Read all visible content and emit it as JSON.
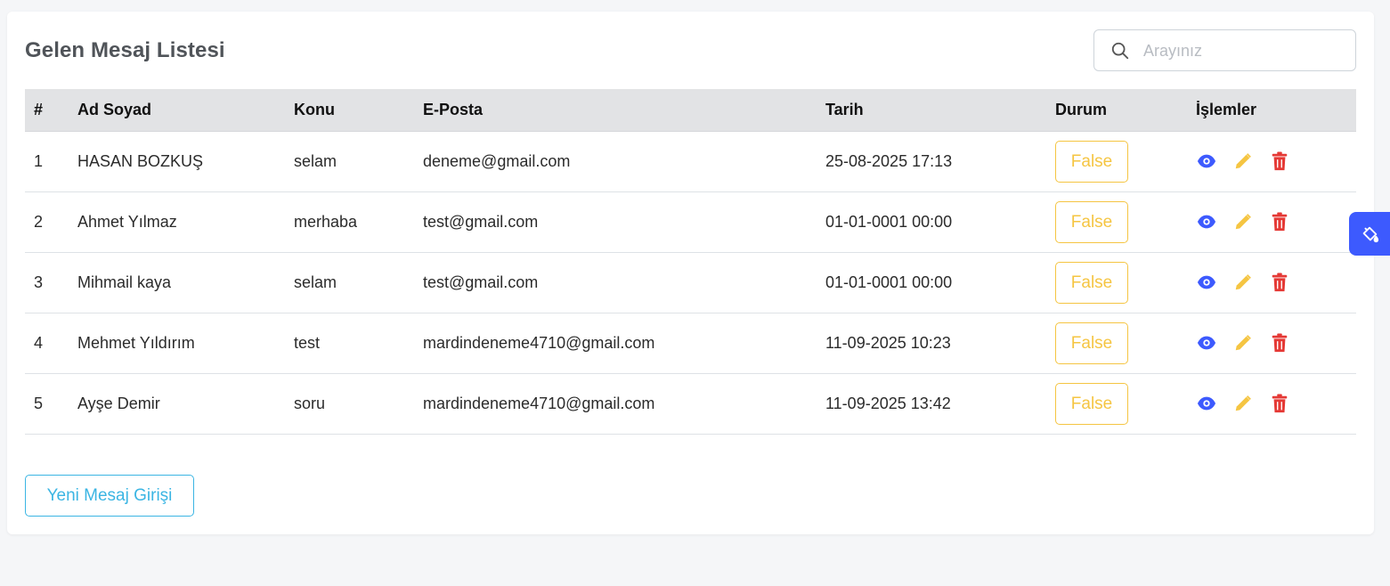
{
  "page": {
    "title": "Gelen Mesaj Listesi"
  },
  "search": {
    "placeholder": "Arayınız",
    "icon": "search-icon"
  },
  "table": {
    "headers": {
      "num": "#",
      "name": "Ad Soyad",
      "topic": "Konu",
      "email": "E-Posta",
      "date": "Tarih",
      "status": "Durum",
      "actions": "İşlemler"
    },
    "rows": [
      {
        "num": "1",
        "name": "HASAN BOZKUŞ",
        "topic": "selam",
        "email": "deneme@gmail.com",
        "date": "25-08-2025 17:13",
        "status": "False"
      },
      {
        "num": "2",
        "name": "Ahmet Yılmaz",
        "topic": "merhaba",
        "email": "test@gmail.com",
        "date": "01-01-0001 00:00",
        "status": "False"
      },
      {
        "num": "3",
        "name": "Mihmail kaya",
        "topic": "selam",
        "email": "test@gmail.com",
        "date": "01-01-0001 00:00",
        "status": "False"
      },
      {
        "num": "4",
        "name": "Mehmet Yıldırım",
        "topic": "test",
        "email": "mardindeneme4710@gmail.com",
        "date": "11-09-2025 10:23",
        "status": "False"
      },
      {
        "num": "5",
        "name": "Ayşe Demir",
        "topic": "soru",
        "email": "mardindeneme4710@gmail.com",
        "date": "11-09-2025 13:42",
        "status": "False"
      }
    ],
    "row_actions": [
      "eye-icon",
      "pencil-icon",
      "trash-icon"
    ]
  },
  "footer": {
    "new_message_label": "Yeni Mesaj Girişi"
  },
  "colors": {
    "status_warning": "#f5c542",
    "view_icon": "#3d5afe",
    "edit_icon": "#f5c542",
    "delete_icon": "#e53935",
    "new_button": "#3bb5e3",
    "theme_tab": "#3d5afe"
  }
}
